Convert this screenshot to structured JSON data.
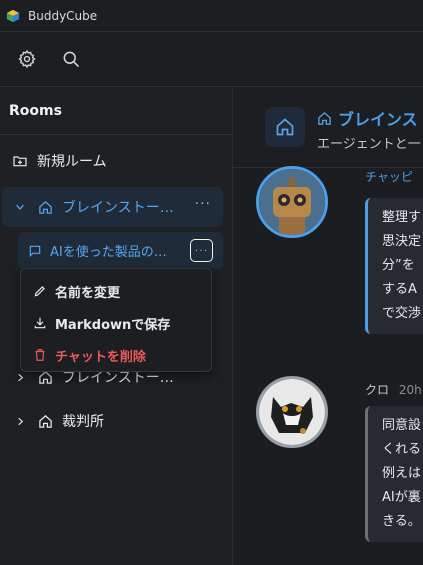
{
  "app": {
    "title": "BuddyCube"
  },
  "toolbar": {
    "settings_icon": "gear-icon",
    "search_icon": "search-icon"
  },
  "sidebar": {
    "header": "Rooms",
    "new_room": "新規ルーム",
    "rooms": [
      {
        "label": "ブレインストー…",
        "more": "···",
        "expanded": true
      },
      {
        "label": "ブレインストー…",
        "expanded": false
      },
      {
        "label": "裁判所",
        "expanded": false
      }
    ],
    "chat": {
      "label": "AIを使った製品の…",
      "more": "···"
    },
    "context_menu": {
      "rename": "名前を変更",
      "save_markdown": "Markdownで保存",
      "delete_chat": "チャットを削除"
    }
  },
  "main": {
    "header": {
      "title": "ブレインス",
      "subtitle": "エージェントと一"
    },
    "messages": [
      {
        "sender": "チャッピ",
        "lines": [
          "整理す",
          "思決定",
          "分”を",
          "するA",
          "で交渉"
        ]
      },
      {
        "sender": "クロ",
        "time": "20h",
        "lines": [
          "同意設",
          "くれる",
          "例えは",
          "AIが裏",
          "きる。"
        ]
      }
    ]
  },
  "colors": {
    "accent": "#4c9fe8",
    "danger": "#ea5a5a",
    "sidebar_bg": "#1e2024",
    "selected_bg": "#1f2b38"
  }
}
